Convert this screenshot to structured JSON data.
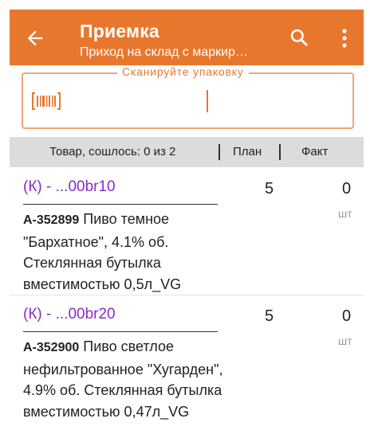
{
  "header": {
    "title": "Приемка",
    "subtitle": "Приход на склад с маркир…"
  },
  "scan": {
    "label": "Сканируйте упаковку"
  },
  "columns": {
    "goods": "Товар, сошлось: 0 из 2",
    "plan": "План",
    "fact": "Факт"
  },
  "items": [
    {
      "code": "(К) - ...00br10",
      "article": "А-352899",
      "name": " Пиво темное \"Бархатное\", 4.1% об. Стеклянная бутылка вместимостью 0,5л_VG",
      "plan": "5",
      "fact": "0",
      "unit": "шт"
    },
    {
      "code": "(К) - ...00br20",
      "article": "А-352900",
      "name": " Пиво светлое нефильтрованное \"Хугарден\", 4.9% об. Стеклянная бутылка вместимостью 0,47л_VG",
      "plan": "5",
      "fact": "0",
      "unit": "шт"
    }
  ],
  "colors": {
    "appbar": "#e8772e",
    "accent": "#e8772e",
    "code_link": "#8a2bc7",
    "column_header_bg": "#dcdcdc"
  }
}
